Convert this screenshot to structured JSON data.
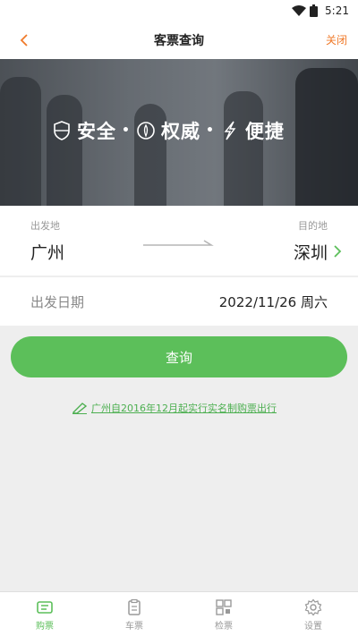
{
  "status": {
    "time": "5:21",
    "icons": [
      "wifi-icon",
      "battery-icon"
    ]
  },
  "nav": {
    "title": "客票查询",
    "back_icon": "chevron-left-icon",
    "close_label": "关闭"
  },
  "banner": {
    "slogans": [
      {
        "icon": "shield-icon",
        "text": "安全"
      },
      {
        "icon": "badge-icon",
        "text": "权威"
      },
      {
        "icon": "lightning-icon",
        "text": "便捷"
      }
    ],
    "separator": "•"
  },
  "route": {
    "from_label": "出发地",
    "from_city": "广州",
    "to_label": "目的地",
    "to_city": "深圳",
    "arrow_icon": "arrow-right-icon",
    "chevron_icon": "chevron-right-icon"
  },
  "date": {
    "label": "出发日期",
    "value": "2022/11/26 周六"
  },
  "query": {
    "label": "查询"
  },
  "notice": {
    "icon": "pencil-icon",
    "text": "广州自2016年12月起实行实名制购票出行"
  },
  "tabs": [
    {
      "label": "购票",
      "icon": "ticket-icon",
      "active": true
    },
    {
      "label": "车票",
      "icon": "clipboard-icon",
      "active": false
    },
    {
      "label": "检票",
      "icon": "qrcode-icon",
      "active": false
    },
    {
      "label": "设置",
      "icon": "gear-icon",
      "active": false
    }
  ],
  "colors": {
    "accent": "#5cbf5a",
    "close": "#f07a2a",
    "background": "#eeeeee"
  }
}
